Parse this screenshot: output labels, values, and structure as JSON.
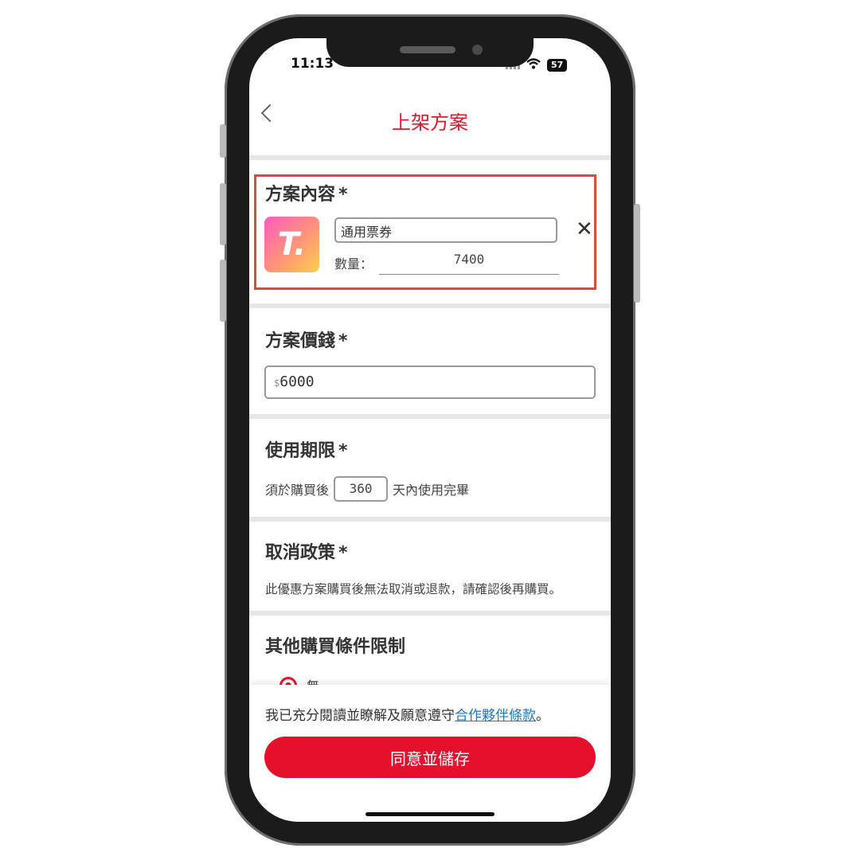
{
  "status_bar": {
    "time": "11:13",
    "battery": "57"
  },
  "header": {
    "title": "上架方案"
  },
  "plan_content": {
    "title": "方案內容",
    "required_mark": "*",
    "logo_letter": "T.",
    "ticket_name": "通用票券",
    "quantity_label": "數量：",
    "quantity_value": "7400"
  },
  "plan_price": {
    "title": "方案價錢",
    "required_mark": "*",
    "currency_symbol": "$",
    "value": "6000"
  },
  "usage_period": {
    "title": "使用期限",
    "required_mark": "*",
    "prefix": "須於購買後",
    "days": "360",
    "suffix": "天內使用完畢"
  },
  "cancel_policy": {
    "title": "取消政策",
    "required_mark": "*",
    "text": "此優惠方案購買後無法取消或退款，請確認後再購買。"
  },
  "other_conditions": {
    "title": "其他購買條件限制",
    "option_none": "無"
  },
  "footer": {
    "agree_prefix": "我已充分閱讀並瞭解及願意遵守",
    "agree_link": "合作夥伴條款",
    "agree_suffix": "。",
    "save_label": "同意並儲存"
  },
  "colors": {
    "accent": "#e5112c",
    "title_red": "#e0182d",
    "link": "#1f78c1",
    "highlight": "#e2473a"
  }
}
